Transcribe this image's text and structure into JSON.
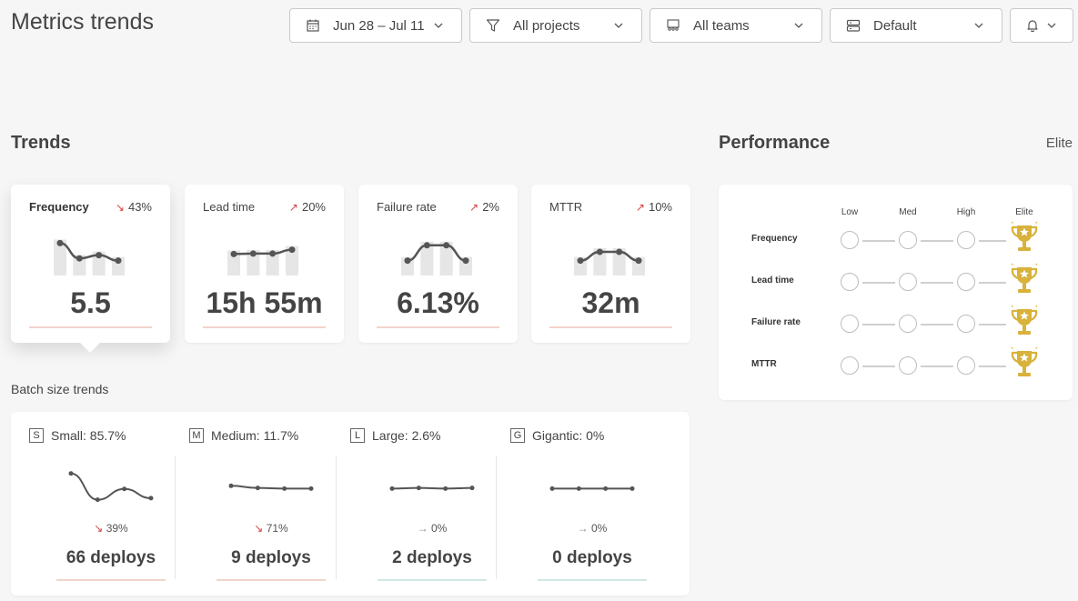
{
  "header": {
    "title": "Metrics trends",
    "filters": [
      {
        "label": "Jun 28 – Jul 11",
        "icon": "calendar-icon"
      },
      {
        "label": "All projects",
        "icon": "filter-icon"
      },
      {
        "label": "All teams",
        "icon": "team-icon"
      },
      {
        "label": "Default",
        "icon": "server-icon"
      }
    ],
    "notification_icon": "bell-icon"
  },
  "trends": {
    "title": "Trends",
    "cards": [
      {
        "title": "Frequency",
        "delta": "43%",
        "direction": "down",
        "value": "5.5",
        "spark": [
          0.9,
          0.2,
          0.35,
          0.1
        ]
      },
      {
        "title": "Lead time",
        "delta": "20%",
        "direction": "up",
        "value": "15h 55m",
        "spark": [
          0.4,
          0.42,
          0.42,
          0.6
        ]
      },
      {
        "title": "Failure rate",
        "delta": "2%",
        "direction": "up",
        "value": "6.13%",
        "spark": [
          0.1,
          0.8,
          0.8,
          0.1
        ]
      },
      {
        "title": "MTTR",
        "delta": "10%",
        "direction": "up",
        "value": "32m",
        "spark": [
          0.1,
          0.5,
          0.5,
          0.1
        ]
      }
    ]
  },
  "batch": {
    "title": "Batch size trends",
    "items": [
      {
        "badge": "S",
        "label": "Small: 85.7%",
        "arrow": "↘",
        "delta": "39%",
        "direction": "down",
        "value": "66 deploys",
        "spark": [
          0.95,
          0.1,
          0.45,
          0.15
        ]
      },
      {
        "badge": "M",
        "label": "Medium: 11.7%",
        "arrow": "↘",
        "delta": "71%",
        "direction": "down",
        "value": "9 deploys",
        "spark": [
          0.55,
          0.48,
          0.46,
          0.46
        ]
      },
      {
        "badge": "L",
        "label": "Large: 2.6%",
        "arrow": "→",
        "delta": "0%",
        "direction": "flat",
        "value": "2 deploys",
        "spark": [
          0.46,
          0.48,
          0.46,
          0.48
        ]
      },
      {
        "badge": "G",
        "label": "Gigantic: 0%",
        "arrow": "→",
        "delta": "0%",
        "direction": "flat",
        "value": "0 deploys",
        "spark": [
          0.46,
          0.46,
          0.46,
          0.46
        ]
      }
    ]
  },
  "performance": {
    "title": "Performance",
    "level": "Elite",
    "columns": [
      "Low",
      "Med",
      "High",
      "Elite"
    ],
    "rows": [
      {
        "label": "Frequency",
        "level": "Elite"
      },
      {
        "label": "Lead time",
        "level": "Elite"
      },
      {
        "label": "Failure rate",
        "level": "Elite"
      },
      {
        "label": "MTTR",
        "level": "Elite"
      }
    ]
  },
  "colors": {
    "negative": "#d64141",
    "trophy": "#d8b23a",
    "underline_bad": "#f2d4cb",
    "underline_neutral": "#cfe8e4"
  }
}
